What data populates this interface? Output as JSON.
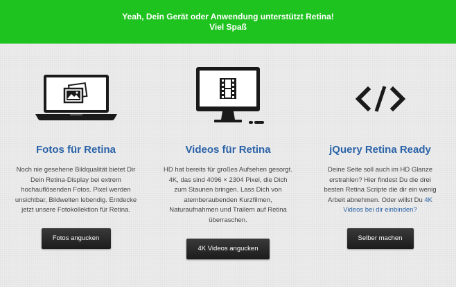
{
  "banner": {
    "line1": "Yeah, Dein Gerät oder Anwendung unterstützt Retina!",
    "line2": "Viel Spaß",
    "color": "#1fc31f"
  },
  "features": [
    {
      "icon": "laptop-photo-icon",
      "title": "Fotos für Retina",
      "text": "Noch nie gesehene Bildqualität bietet Dir Dein Retina-Display bei extrem hochauflösenden Fotos. Pixel werden unsichtbar, Bildwelten lebendig. Entdecke jetzt unsere Fotokollektion für Retina.",
      "button": "Fotos angucken"
    },
    {
      "icon": "monitor-film-icon",
      "title": "Videos für Retina",
      "text": "HD hat bereits für großes Aufsehen gesorgt. 4K, das sind 4096 × 2304 Pixel, die Dich zum Staunen bringen. Lass Dich von atemberaubenden Kurzfilmen, Naturaufnahmen und Trailern auf Retina überraschen.",
      "button": "4K Videos angucken"
    },
    {
      "icon": "code-brackets-icon",
      "title": "jQuery Retina Ready",
      "text_before": "Deine Seite soll auch im HD Glanze erstrahlen? Hier findest Du die drei besten Retina Scripte die dir ein wenig Arbeit abnehmen. Oder willst Du ",
      "link": "4K Videos bei dir einbinden?",
      "button": "Selber machen"
    }
  ],
  "colors": {
    "accent": "#2b63a8",
    "background": "#ececec"
  }
}
